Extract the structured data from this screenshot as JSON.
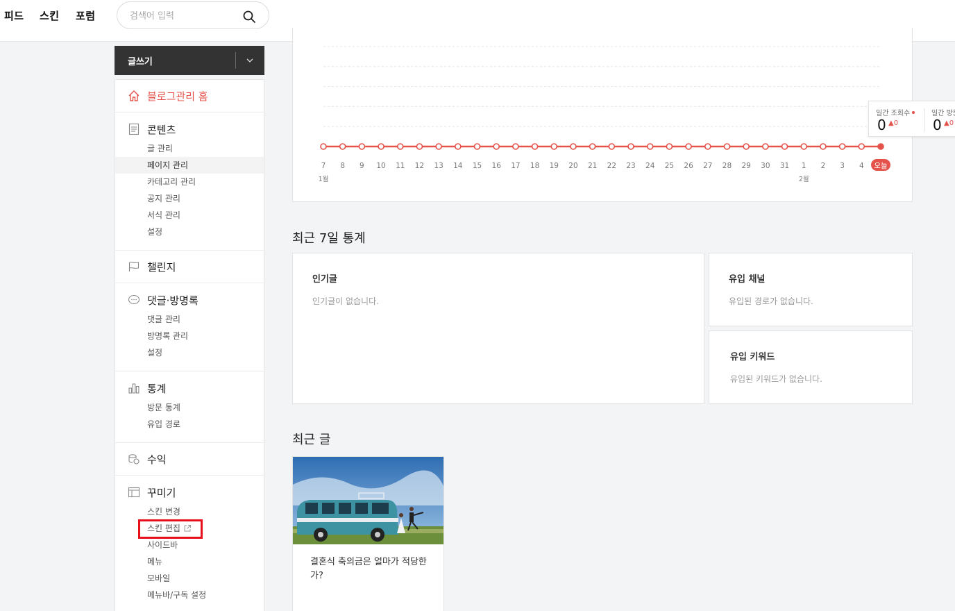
{
  "topnav": {
    "items": [
      "피드",
      "스킨",
      "포럼"
    ]
  },
  "search": {
    "placeholder": "검색어 입력"
  },
  "write": {
    "label": "글쓰기"
  },
  "sidebar": {
    "home": "블로그관리 홈",
    "content": {
      "title": "콘텐츠",
      "items": [
        "글 관리",
        "페이지 관리",
        "카테고리 관리",
        "공지 관리",
        "서식 관리",
        "설정"
      ]
    },
    "challenge": {
      "title": "챌린지"
    },
    "comments": {
      "title": "댓글·방명록",
      "items": [
        "댓글 관리",
        "방명록 관리",
        "설정"
      ]
    },
    "stats": {
      "title": "통계",
      "items": [
        "방문 통계",
        "유입 경로"
      ]
    },
    "revenue": {
      "title": "수익"
    },
    "decorate": {
      "title": "꾸미기",
      "items": [
        "스킨 변경",
        "스킨 편집",
        "사이드바",
        "메뉴",
        "모바일",
        "메뉴바/구독 설정"
      ]
    }
  },
  "chart_data": {
    "type": "line",
    "x": [
      "7",
      "8",
      "9",
      "10",
      "11",
      "12",
      "13",
      "14",
      "15",
      "16",
      "17",
      "18",
      "19",
      "20",
      "21",
      "22",
      "23",
      "24",
      "25",
      "26",
      "27",
      "28",
      "29",
      "30",
      "31",
      "1",
      "2",
      "3",
      "4",
      "오늘"
    ],
    "month_labels": [
      {
        "at": "7",
        "label": "1월"
      },
      {
        "at": "1",
        "label": "2월"
      }
    ],
    "series": [
      {
        "values": [
          0,
          0,
          0,
          0,
          0,
          0,
          0,
          0,
          0,
          0,
          0,
          0,
          0,
          0,
          0,
          0,
          0,
          0,
          0,
          0,
          0,
          0,
          0,
          0,
          0,
          0,
          0,
          0,
          0,
          0
        ]
      }
    ],
    "ylim": [
      0,
      5
    ],
    "grid": true,
    "color": "#e4524b"
  },
  "tooltip": {
    "daily_views_label": "일간 조회수",
    "daily_views_value": "0",
    "daily_views_delta": "0",
    "daily_visitors_label": "일간 방문",
    "daily_visitors_value": "0",
    "daily_visitors_delta": "0"
  },
  "stats7": {
    "title": "최근 7일 통계",
    "popular": {
      "title": "인기글",
      "empty": "인기글이 없습니다."
    },
    "channels": {
      "title": "유입 채널",
      "empty": "유입된 경로가 없습니다."
    },
    "keywords": {
      "title": "유입 키워드",
      "empty": "유입된 키워드가 없습니다."
    }
  },
  "recent": {
    "title": "최근 글",
    "posts": [
      {
        "title": "결혼식 축의금은 얼마가 적당한가?"
      }
    ]
  },
  "colors": {
    "accent": "#e4524b",
    "highlight": "#e8101c",
    "write_bg": "#333333"
  }
}
